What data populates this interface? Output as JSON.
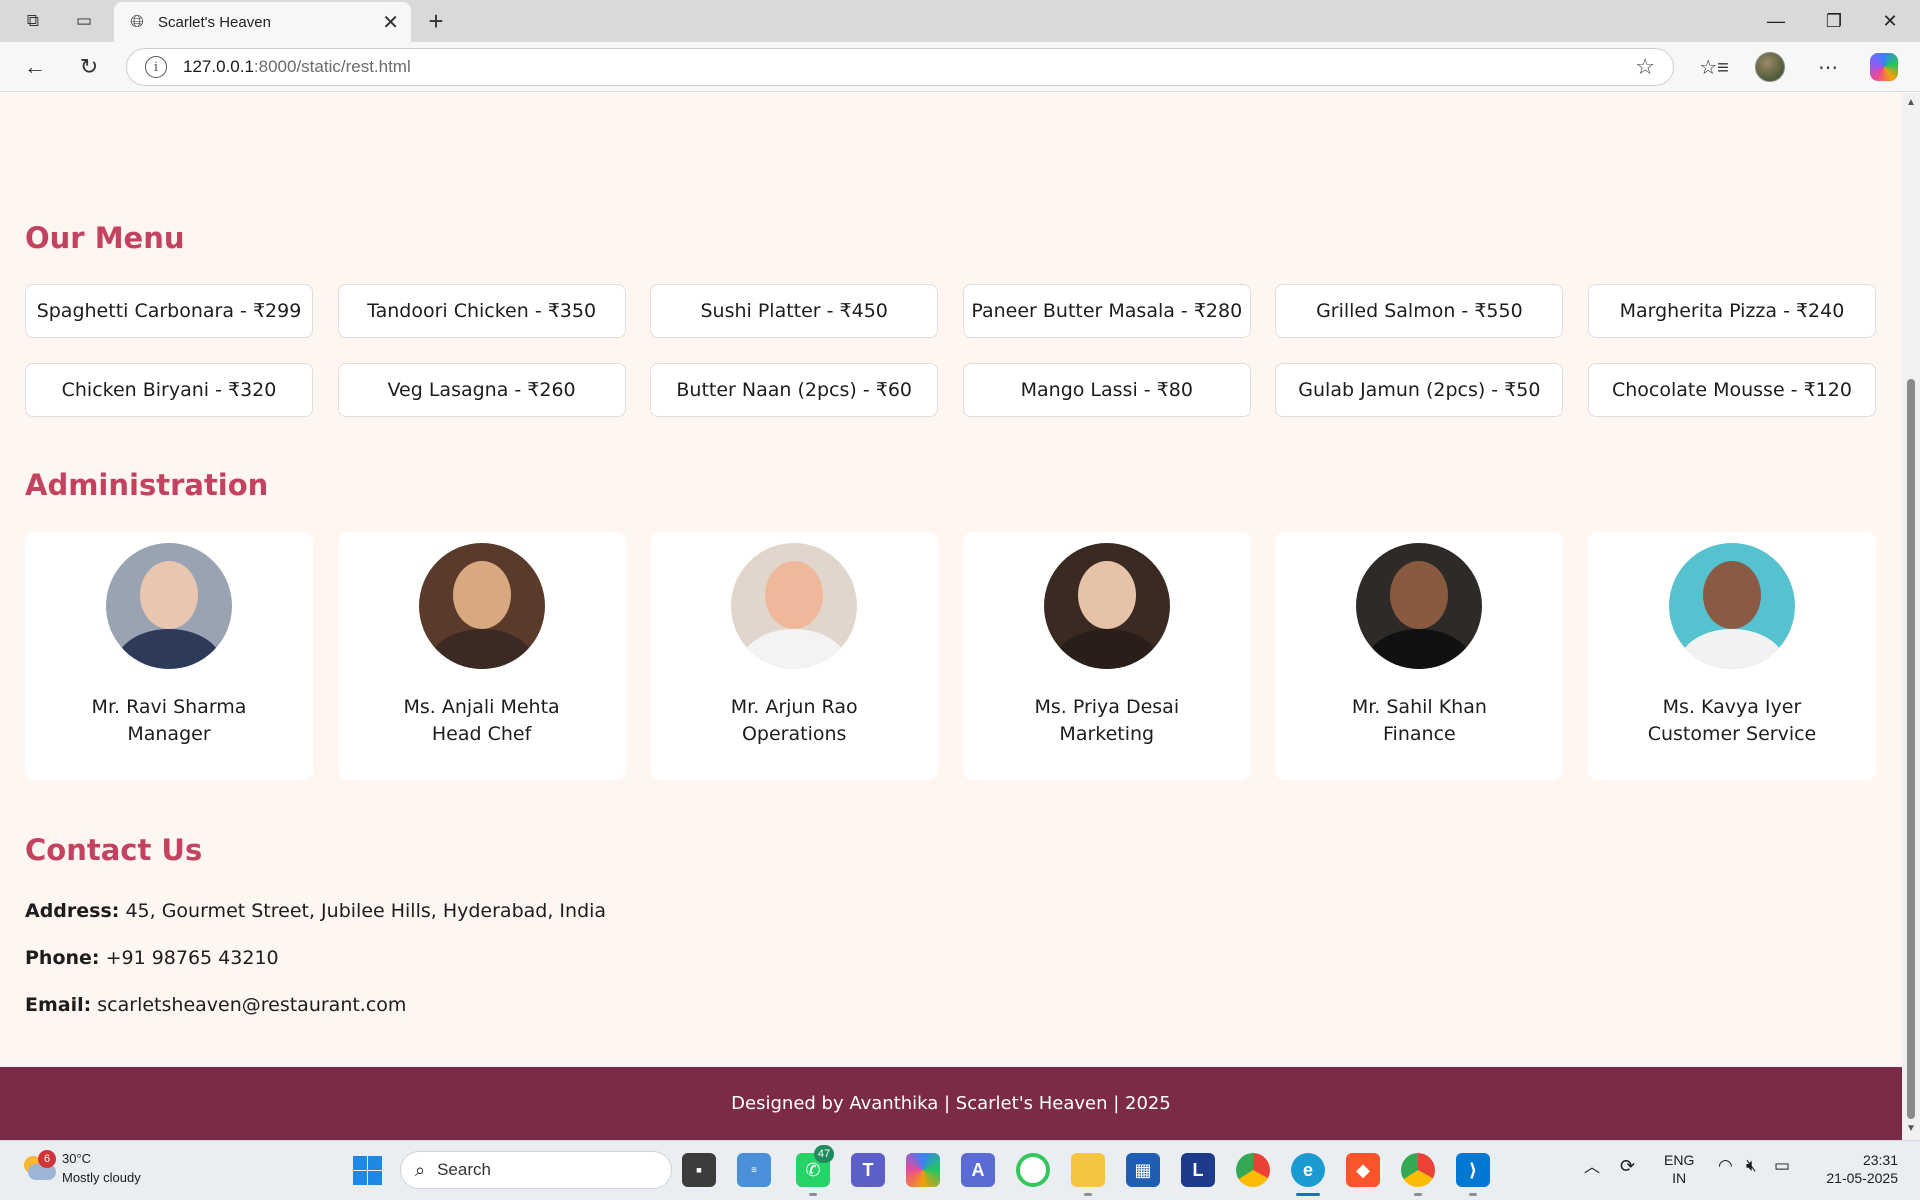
{
  "browser": {
    "tab_title": "Scarlet's Heaven",
    "url_host": "127.0.0.1",
    "url_path": ":8000/static/rest.html"
  },
  "page": {
    "menu_title": "Our Menu",
    "menu_items": [
      "Spaghetti Carbonara - ₹299",
      "Tandoori Chicken - ₹350",
      "Sushi Platter - ₹450",
      "Paneer Butter Masala - ₹280",
      "Grilled Salmon - ₹550",
      "Margherita Pizza - ₹240",
      "Chicken Biryani - ₹320",
      "Veg Lasagna - ₹260",
      "Butter Naan (2pcs) - ₹60",
      "Mango Lassi - ₹80",
      "Gulab Jamun (2pcs) - ₹50",
      "Chocolate Mousse - ₹120"
    ],
    "admin_title": "Administration",
    "admins": [
      {
        "name": "Mr. Ravi Sharma",
        "role": "Manager"
      },
      {
        "name": "Ms. Anjali Mehta",
        "role": "Head Chef"
      },
      {
        "name": "Mr. Arjun Rao",
        "role": "Operations"
      },
      {
        "name": "Ms. Priya Desai",
        "role": "Marketing"
      },
      {
        "name": "Mr. Sahil Khan",
        "role": "Finance"
      },
      {
        "name": "Ms. Kavya Iyer",
        "role": "Customer Service"
      }
    ],
    "contact_title": "Contact Us",
    "contact": {
      "address_label": "Address:",
      "address": "45, Gourmet Street, Jubilee Hills, Hyderabad, India",
      "phone_label": "Phone:",
      "phone": "+91 98765 43210",
      "email_label": "Email:",
      "email": "scarletsheaven@restaurant.com"
    },
    "footer": "Designed by Avanthika | Scarlet's Heaven | 2025"
  },
  "taskbar": {
    "weather_temp": "30°C",
    "weather_desc": "Mostly cloudy",
    "weather_badge": "6",
    "search_placeholder": "Search",
    "whatsapp_badge": "47",
    "lang_top": "ENG",
    "lang_bottom": "IN",
    "time": "23:31",
    "date": "21-05-2025"
  },
  "colors": {
    "accent": "#c2425f",
    "page_bg": "#fff5f1",
    "footer_bg": "#7b2b47"
  }
}
